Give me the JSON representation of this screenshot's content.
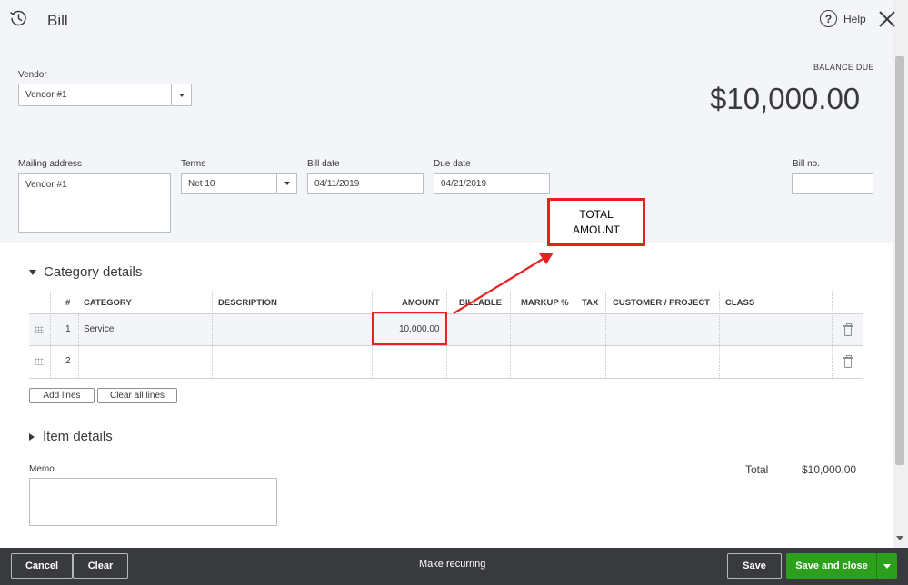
{
  "header": {
    "title": "Bill",
    "help_label": "Help"
  },
  "vendor": {
    "label": "Vendor",
    "value": "Vendor #1"
  },
  "balance": {
    "label": "BALANCE DUE",
    "amount": "$10,000.00"
  },
  "mailing": {
    "label": "Mailing address",
    "value": "Vendor #1"
  },
  "terms": {
    "label": "Terms",
    "value": "Net 10"
  },
  "bill_date": {
    "label": "Bill date",
    "value": "04/11/2019"
  },
  "due_date": {
    "label": "Due date",
    "value": "04/21/2019"
  },
  "bill_no": {
    "label": "Bill no.",
    "value": ""
  },
  "annotation": {
    "line1": "TOTAL",
    "line2": "AMOUNT"
  },
  "category": {
    "heading": "Category details",
    "columns": [
      "#",
      "CATEGORY",
      "DESCRIPTION",
      "AMOUNT",
      "BILLABLE",
      "MARKUP %",
      "TAX",
      "CUSTOMER / PROJECT",
      "CLASS"
    ],
    "rows": [
      {
        "num": "1",
        "category": "Service",
        "description": "",
        "amount": "10,000.00"
      },
      {
        "num": "2",
        "category": "",
        "description": "",
        "amount": ""
      }
    ],
    "add_lines": "Add lines",
    "clear_all_lines": "Clear all lines"
  },
  "item": {
    "heading": "Item details"
  },
  "memo": {
    "label": "Memo",
    "value": ""
  },
  "total": {
    "label": "Total",
    "value": "$10,000.00"
  },
  "footer": {
    "cancel": "Cancel",
    "clear": "Clear",
    "make_recurring": "Make recurring",
    "save": "Save",
    "save_and_close": "Save and close"
  },
  "colors": {
    "accent_green": "#2ca01c",
    "annotation_red": "#e8211f",
    "footer_bg": "#393a3d"
  }
}
